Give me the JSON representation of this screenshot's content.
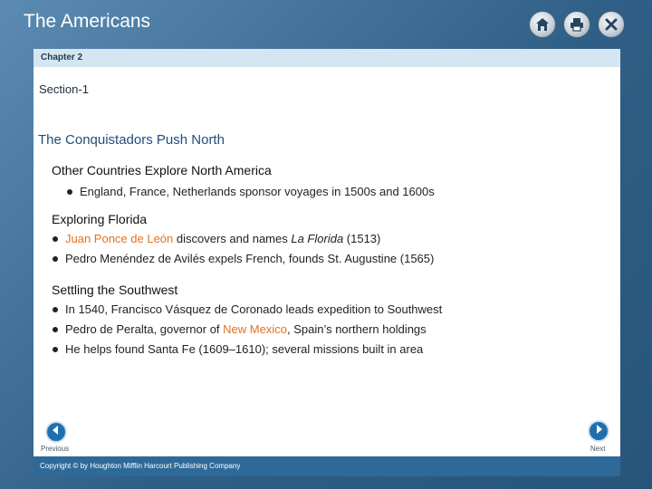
{
  "app": {
    "title": "The Americans",
    "icons": {
      "home": "home-icon",
      "print": "print-icon",
      "close": "close-icon"
    }
  },
  "chapter": {
    "label": "Chapter 2"
  },
  "section": {
    "label": "Section-1"
  },
  "main": {
    "title": "The Conquistadors Push North",
    "groups": [
      {
        "heading": "Other Countries Explore North America",
        "items": [
          {
            "text": "England, France, Netherlands sponsor voyages in 1500s and 1600s"
          }
        ]
      },
      {
        "heading": "Exploring Florida",
        "items": [
          {
            "highlight": "Juan Ponce de León",
            "mid": " discovers and names ",
            "italic": "La Florida",
            "rest": " (1513)"
          },
          {
            "text": "Pedro Menéndez de Avilés expels French, founds St. Augustine (1565)"
          }
        ]
      },
      {
        "heading": "Settling the Southwest",
        "items": [
          {
            "text": "In 1540, Francisco Vásquez de Coronado leads expedition to Southwest"
          },
          {
            "pre": "Pedro de Peralta, governor of ",
            "highlight": "New Mexico",
            "rest": ", Spain’s northern holdings"
          },
          {
            "text": "He helps found Santa Fe (1609–1610); several missions built in area"
          }
        ]
      }
    ]
  },
  "nav": {
    "previous_label": "Previous",
    "next_label": "Next"
  },
  "footer": {
    "copyright": "Copyright © by Houghton Mifflin Harcourt Publishing Company"
  },
  "colors": {
    "accent": "#e37222",
    "title_blue": "#1f4e79",
    "chapter_bar": "#d4e6f1",
    "footer_bar": "#2e6a99"
  }
}
